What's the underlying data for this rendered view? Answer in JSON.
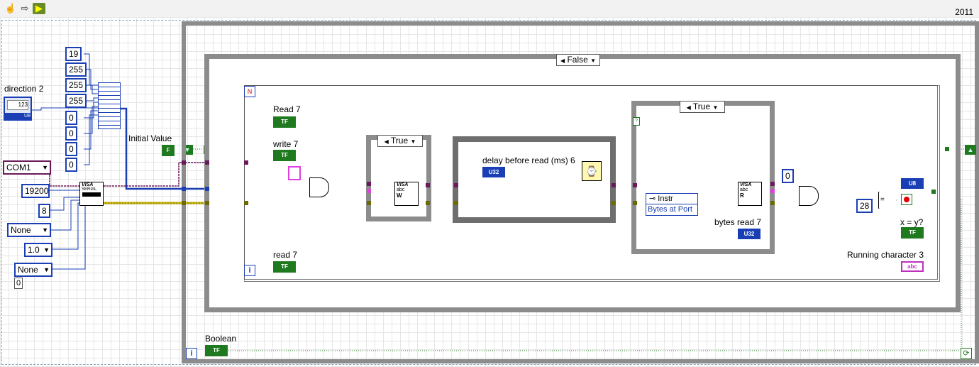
{
  "window": {
    "year": "2011",
    "toolbar": [
      "hand-tool-icon",
      "run-arrow-icon",
      "run-continuously-icon"
    ]
  },
  "constants": {
    "array_values": [
      "19",
      "255",
      "255",
      "255",
      "0",
      "0",
      "0",
      "0"
    ],
    "direction_label": "direction  2",
    "direction_control": "123",
    "direction_type": "U8",
    "com_port": "COM1",
    "baud_rate": "19200",
    "data_bits": "8",
    "parity": "None",
    "stop_bits": "1.0",
    "flow_control": "None",
    "small_zero": "0",
    "initial_value_label": "Initial Value",
    "initial_value": "F",
    "zero_const": "0",
    "compare_const": "28"
  },
  "case_structures": {
    "outer_selector": "False",
    "write_selector": "True",
    "read_selector": "True"
  },
  "labels": {
    "read7": "Read 7",
    "write7": "write 7",
    "read7b": "read 7",
    "delay": "delay before read (ms) 6",
    "bytes_read": "bytes read 7",
    "running_char": "Running character 3",
    "xy": "x = y?",
    "boolean": "Boolean",
    "instr": "Instr",
    "bytes_at_port": "Bytes at Port",
    "visa_serial": "VISA",
    "visa_serial2": "SERIAL",
    "visa_write": "VISA",
    "visa_write_abc": "abc",
    "visa_write_w": "W",
    "visa_read": "VISA",
    "visa_read_abc": "abc",
    "visa_read_r": "R"
  },
  "indicators": {
    "tf": "TF",
    "u32": "U32",
    "u8": "U8",
    "abc": "abc",
    "iter": "i"
  },
  "colors": {
    "numeric_wire": "#1a3fb4",
    "refnum_wire": "#6a1a5a",
    "error_wire": "#c8b400",
    "boolean_wire": "#1f7a1f",
    "string_wire": "#e040e0",
    "structure_border": "#8c8c8c"
  }
}
